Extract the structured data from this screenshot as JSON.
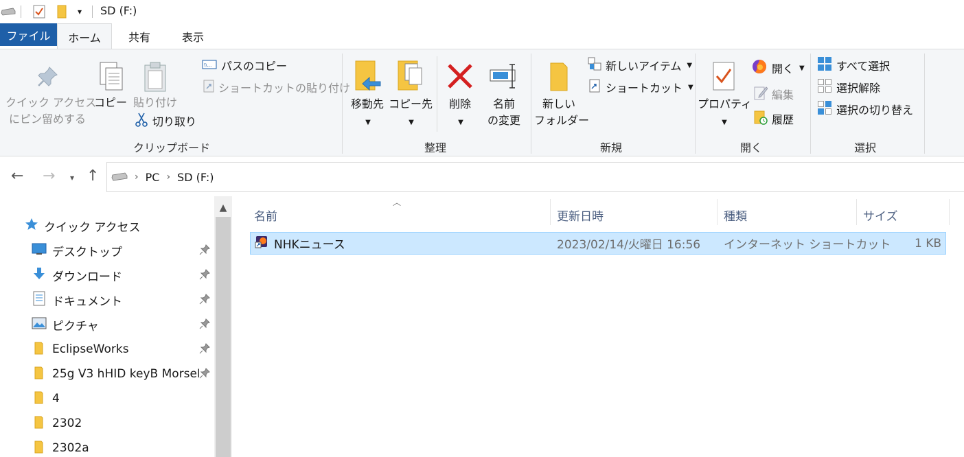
{
  "window": {
    "title": "SD (F:)"
  },
  "tabs": {
    "file": "ファイル",
    "home": "ホーム",
    "share": "共有",
    "view": "表示"
  },
  "ribbon": {
    "clipboard": {
      "pin_line1": "クイック アクセス",
      "pin_line2": "にピン留めする",
      "copy": "コピー",
      "paste": "貼り付け",
      "copy_path": "パスのコピー",
      "paste_shortcut": "ショートカットの貼り付け",
      "cut": "切り取り",
      "label": "クリップボード"
    },
    "organize": {
      "move_to": "移動先",
      "copy_to": "コピー先",
      "delete": "削除",
      "rename_line1": "名前",
      "rename_line2": "の変更",
      "label": "整理"
    },
    "new": {
      "new_folder_line1": "新しい",
      "new_folder_line2": "フォルダー",
      "new_item": "新しいアイテム",
      "shortcut": "ショートカット",
      "label": "新規"
    },
    "open": {
      "properties": "プロパティ",
      "open": "開く",
      "edit": "編集",
      "history": "履歴",
      "label": "開く"
    },
    "select": {
      "select_all": "すべて選択",
      "select_none": "選択解除",
      "invert": "選択の切り替え",
      "label": "選択"
    }
  },
  "address": {
    "crumbs": [
      "PC",
      "SD (F:)"
    ]
  },
  "nav_pane": {
    "quick_access": "クイック アクセス",
    "items": [
      {
        "label": "デスクトップ",
        "icon": "desktop-icon",
        "pinned": true
      },
      {
        "label": "ダウンロード",
        "icon": "download-icon",
        "pinned": true
      },
      {
        "label": "ドキュメント",
        "icon": "document-icon",
        "pinned": true
      },
      {
        "label": "ピクチャ",
        "icon": "picture-icon",
        "pinned": true
      },
      {
        "label": "EclipseWorks",
        "icon": "folder-icon",
        "pinned": true
      },
      {
        "label": "25g V3  hHID keyB MorseF",
        "icon": "folder-icon",
        "pinned": true
      },
      {
        "label": "4",
        "icon": "folder-icon",
        "pinned": false
      },
      {
        "label": "2302",
        "icon": "folder-icon",
        "pinned": false
      },
      {
        "label": "2302a",
        "icon": "folder-icon",
        "pinned": false
      }
    ]
  },
  "file_list": {
    "columns": {
      "name": "名前",
      "modified": "更新日時",
      "type": "種類",
      "size": "サイズ"
    },
    "rows": [
      {
        "name": "NHKニュース",
        "modified": "2023/02/14/火曜日 16:56",
        "type": "インターネット ショートカット",
        "size": "1 KB",
        "selected": true
      }
    ]
  },
  "colors": {
    "file_tab": "#1e5fa8",
    "ribbon_bg": "#f4f6f8",
    "selection": "#cce8ff",
    "selection_border": "#99d1ff",
    "header_text": "#4d6082"
  }
}
